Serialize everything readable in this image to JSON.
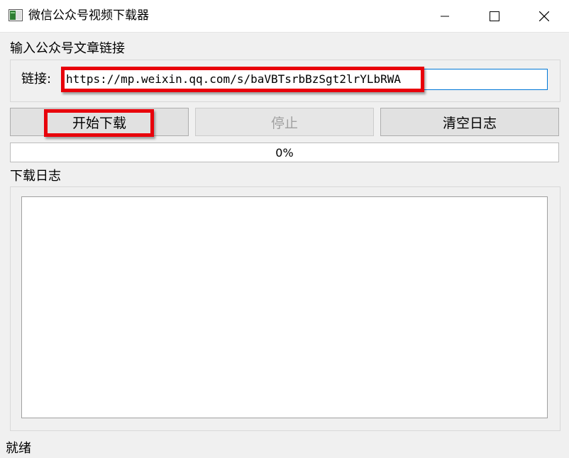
{
  "window": {
    "title": "微信公众号视频下载器",
    "controls": [
      "minimize",
      "maximize",
      "close"
    ]
  },
  "input_section": {
    "label": "输入公众号文章链接",
    "link_label": "链接:",
    "url_value": "https://mp.weixin.qq.com/s/baVBTsrbBzSgt2lrYLbRWA"
  },
  "buttons": {
    "start": "开始下载",
    "stop": "停止",
    "clear_log": "清空日志"
  },
  "progress": {
    "percent": 0,
    "text": "0%"
  },
  "log_section": {
    "label": "下载日志",
    "content": ""
  },
  "status_bar": {
    "text": "就绪"
  },
  "colors": {
    "highlight": "#e8000b",
    "input_focus": "#0078d7",
    "progress_fill": "#06b025"
  }
}
